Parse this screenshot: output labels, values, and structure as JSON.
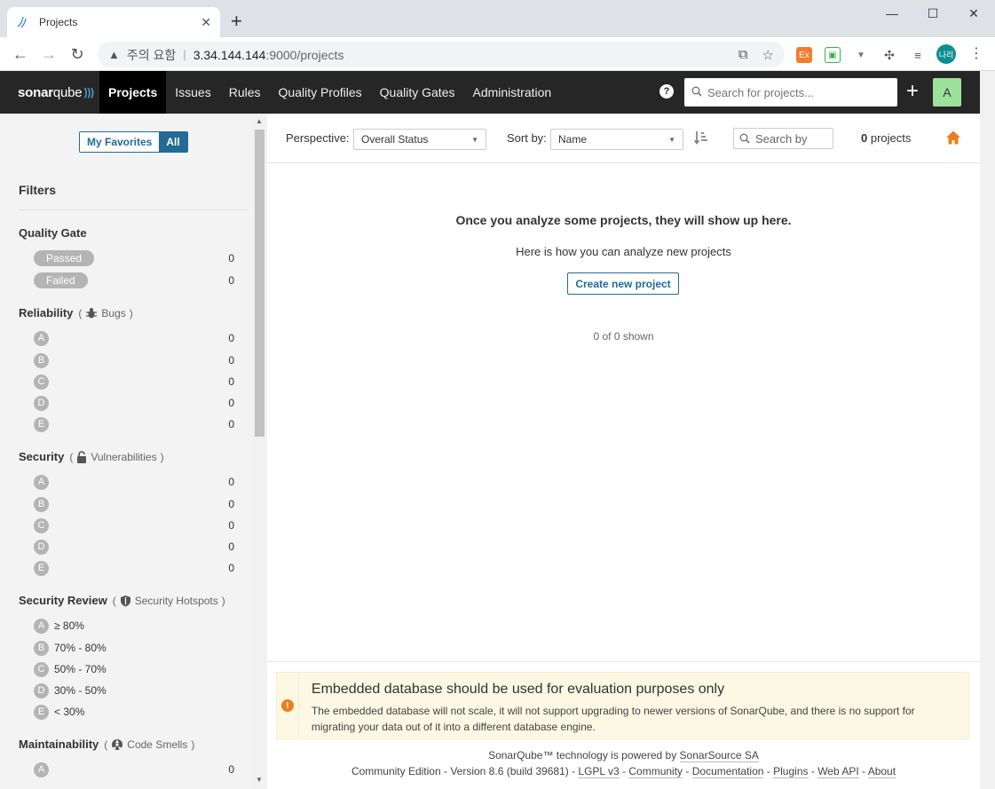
{
  "browser": {
    "tab_title": "Projects",
    "security_label": "주의 요함",
    "url_host": "3.34.144.144",
    "url_port_path": ":9000/projects",
    "profile_initials": "나리"
  },
  "nav": {
    "logo_main": "sonar",
    "logo_sub": "qube",
    "items": [
      "Projects",
      "Issues",
      "Rules",
      "Quality Profiles",
      "Quality Gates",
      "Administration"
    ],
    "search_placeholder": "Search for projects...",
    "avatar": "A"
  },
  "sidebar": {
    "toggle_favorites": "My Favorites",
    "toggle_all": "All",
    "filters_title": "Filters",
    "quality_gate": {
      "title": "Quality Gate",
      "rows": [
        {
          "label": "Passed",
          "count": "0"
        },
        {
          "label": "Failed",
          "count": "0"
        }
      ]
    },
    "reliability": {
      "title": "Reliability",
      "metric": "Bugs",
      "rows": [
        {
          "grade": "A",
          "count": "0"
        },
        {
          "grade": "B",
          "count": "0"
        },
        {
          "grade": "C",
          "count": "0"
        },
        {
          "grade": "D",
          "count": "0"
        },
        {
          "grade": "E",
          "count": "0"
        }
      ]
    },
    "security": {
      "title": "Security",
      "metric": "Vulnerabilities",
      "rows": [
        {
          "grade": "A",
          "count": "0"
        },
        {
          "grade": "B",
          "count": "0"
        },
        {
          "grade": "C",
          "count": "0"
        },
        {
          "grade": "D",
          "count": "0"
        },
        {
          "grade": "E",
          "count": "0"
        }
      ]
    },
    "security_review": {
      "title": "Security Review",
      "metric": "Security Hotspots",
      "rows": [
        {
          "grade": "A",
          "label": "≥ 80%"
        },
        {
          "grade": "B",
          "label": "70% - 80%"
        },
        {
          "grade": "C",
          "label": "50% - 70%"
        },
        {
          "grade": "D",
          "label": "30% - 50%"
        },
        {
          "grade": "E",
          "label": "< 30%"
        }
      ]
    },
    "maintainability": {
      "title": "Maintainability",
      "metric": "Code Smells",
      "rows": [
        {
          "grade": "A",
          "count": "0"
        }
      ]
    },
    "paren_open": "(",
    "paren_close": ")"
  },
  "main": {
    "perspective_label": "Perspective:",
    "perspective_value": "Overall Status",
    "sort_label": "Sort by:",
    "sort_value": "Name",
    "search_placeholder": "Search by",
    "count_number": "0",
    "count_label": "projects",
    "empty_title": "Once you analyze some projects, they will show up here.",
    "empty_sub": "Here is how you can analyze new projects",
    "create_button": "Create new project",
    "shown": "0 of 0 shown",
    "alert_title": "Embedded database should be used for evaluation purposes only",
    "alert_text": "The embedded database will not scale, it will not support upgrading to newer versions of SonarQube, and there is no support for migrating your data out of it into a different database engine.",
    "footer_powered": "SonarQube™ technology is powered by",
    "footer_company": "SonarSource SA",
    "footer_edition": "Community Edition - Version 8.6 (build 39681) -",
    "footer_links": [
      "LGPL v3",
      "Community",
      "Documentation",
      "Plugins",
      "Web API",
      "About"
    ],
    "footer_sep": "-"
  },
  "colors": {
    "nav_bg": "#262626",
    "accent": "#236a97",
    "home_icon": "#ed7d20",
    "avatar_bg": "#9be29b"
  }
}
